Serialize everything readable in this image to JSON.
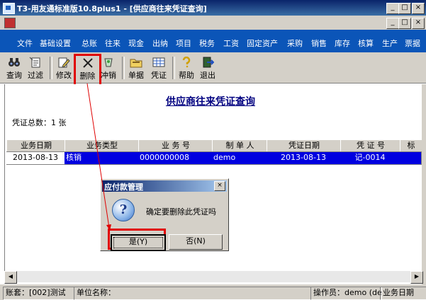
{
  "window": {
    "title": "T3-用友通标准版10.8plus1 - [供应商往来凭证查询]",
    "controls": [
      "_",
      "□",
      "×"
    ]
  },
  "mdi": {
    "controls": [
      "_",
      "□",
      "×"
    ]
  },
  "menu": [
    "文件",
    "基础设置",
    "总账",
    "往来",
    "现金",
    "出纳",
    "项目",
    "税务",
    "工资",
    "固定资产",
    "采购",
    "销售",
    "库存",
    "核算",
    "生产",
    "票据"
  ],
  "toolbar": {
    "query": "查询",
    "filter": "过滤",
    "modify": "修改",
    "delete": "删除",
    "reverse": "冲销",
    "document": "单据",
    "voucher": "凭证",
    "help": "帮助",
    "exit": "退出"
  },
  "page": {
    "title": "供应商往来凭证查询",
    "count": "凭证总数：1 张"
  },
  "table": {
    "headers": [
      "业务日期",
      "业务类型",
      "业 务 号",
      "制 单 人",
      "凭证日期",
      "凭 证 号",
      "标"
    ],
    "rows": [
      [
        "2013-08-13",
        "核销",
        "0000000008",
        "demo",
        "2013-08-13",
        "记-0014",
        ""
      ]
    ]
  },
  "status": {
    "account": "账套：[002]测试",
    "unit": "单位名称：",
    "operator": "操作员：demo (de",
    "bizdate": "业务日期"
  },
  "dialog": {
    "title": "应付款管理",
    "close": "×",
    "icon": "?",
    "message": "确定要删除此凭证吗",
    "yes": "是(Y)",
    "no": "否(N)"
  },
  "colors": {
    "menu_bg": "#0b55b8",
    "selection": "#0000e0",
    "highlight": "#e00000",
    "title_text": "#000080"
  }
}
